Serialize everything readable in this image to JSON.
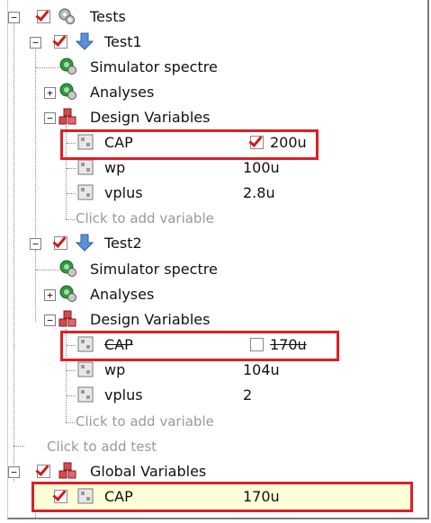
{
  "tree": {
    "root": {
      "label": "Tests",
      "checked": true
    },
    "tests": [
      {
        "label": "Test1",
        "checked": true,
        "simulator": "Simulator spectre",
        "analyses": "Analyses",
        "design_vars": "Design Variables",
        "variables": [
          {
            "name": "CAP",
            "value": "200u",
            "enabled": true
          },
          {
            "name": "wp",
            "value": "100u"
          },
          {
            "name": "vplus",
            "value": "2.8u"
          }
        ],
        "add_var": "Click to add variable"
      },
      {
        "label": "Test2",
        "checked": true,
        "simulator": "Simulator spectre",
        "analyses": "Analyses",
        "design_vars": "Design Variables",
        "variables": [
          {
            "name": "CAP",
            "value": "170u",
            "enabled": false
          },
          {
            "name": "wp",
            "value": "104u"
          },
          {
            "name": "vplus",
            "value": "2"
          }
        ],
        "add_var": "Click to add variable"
      }
    ],
    "add_test": "Click to add test",
    "global": {
      "label": "Global Variables",
      "checked": true,
      "variables": [
        {
          "name": "CAP",
          "value": "170u",
          "checked": true
        }
      ]
    }
  },
  "colors": {
    "highlight_box": "#dd1f26",
    "checkmark": "#d11b1b",
    "global_row_bg": "#ffffd8"
  }
}
